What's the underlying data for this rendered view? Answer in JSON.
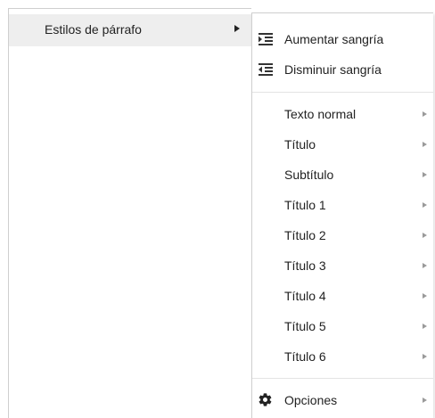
{
  "parent_menu": {
    "items": [
      {
        "label": "Estilos de párrafo",
        "has_submenu": true,
        "highlighted": true
      }
    ]
  },
  "submenu": {
    "indent_items": [
      {
        "label": "Aumentar sangría",
        "icon": "increase-indent-icon"
      },
      {
        "label": "Disminuir sangría",
        "icon": "decrease-indent-icon"
      }
    ],
    "style_items": [
      {
        "label": "Texto normal",
        "has_submenu": true
      },
      {
        "label": "Título",
        "has_submenu": true
      },
      {
        "label": "Subtítulo",
        "has_submenu": true
      },
      {
        "label": "Título 1",
        "has_submenu": true
      },
      {
        "label": "Título 2",
        "has_submenu": true
      },
      {
        "label": "Título 3",
        "has_submenu": true
      },
      {
        "label": "Título 4",
        "has_submenu": true
      },
      {
        "label": "Título 5",
        "has_submenu": true
      },
      {
        "label": "Título 6",
        "has_submenu": true
      }
    ],
    "options_item": {
      "label": "Opciones",
      "icon": "gear-icon",
      "has_submenu": true
    }
  },
  "colors": {
    "highlight": "#eeeeee",
    "text": "#222222",
    "border": "#cfcfcf",
    "sub_arrow": "#9a9a9a"
  }
}
